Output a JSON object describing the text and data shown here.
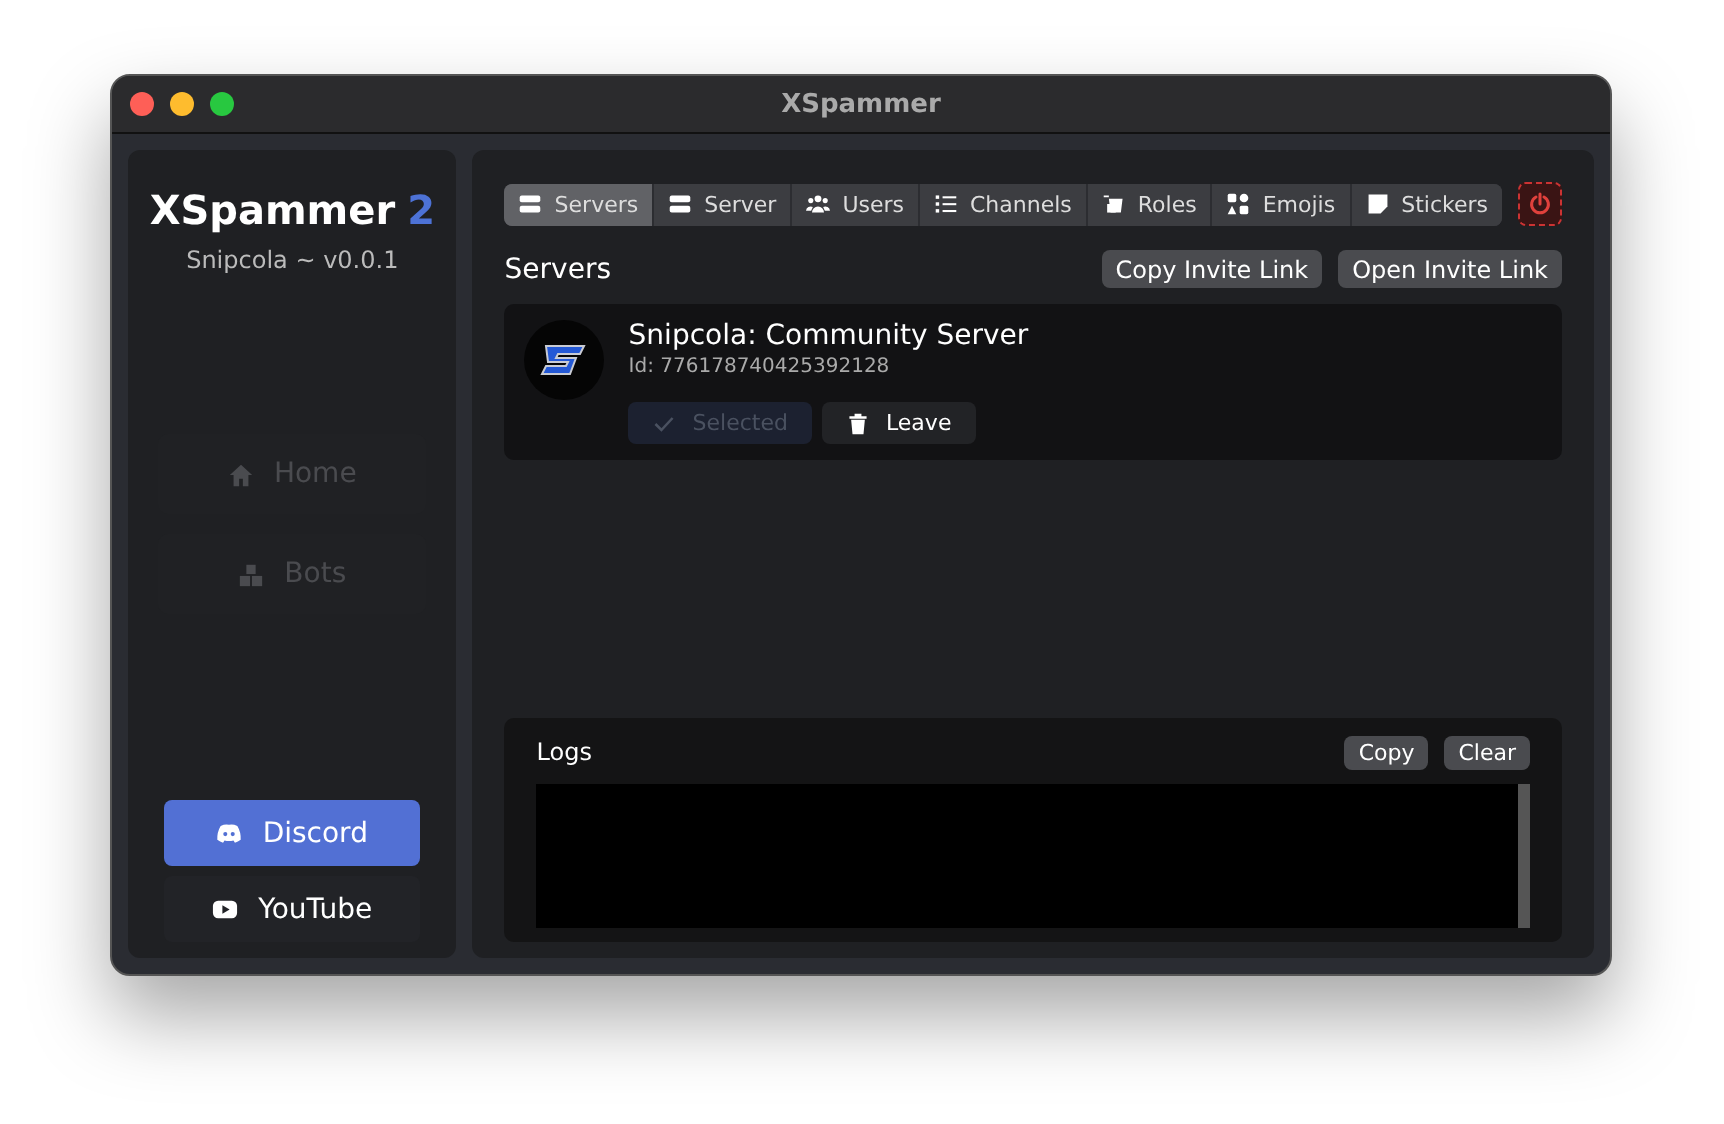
{
  "window": {
    "title": "XSpammer"
  },
  "sidebar": {
    "app_name": "XSpammer",
    "app_version_badge": "2",
    "subtitle": "Snipcola ~ v0.0.1",
    "nav": [
      {
        "label": "Home",
        "disabled": true
      },
      {
        "label": "Bots",
        "disabled": true
      }
    ],
    "links": [
      {
        "label": "Discord",
        "selected": true
      },
      {
        "label": "YouTube",
        "selected": false
      }
    ]
  },
  "tabs": [
    {
      "label": "Servers",
      "selected": true
    },
    {
      "label": "Server",
      "selected": false
    },
    {
      "label": "Users",
      "selected": false
    },
    {
      "label": "Channels",
      "selected": false
    },
    {
      "label": "Roles",
      "selected": false
    },
    {
      "label": "Emojis",
      "selected": false
    },
    {
      "label": "Stickers",
      "selected": false
    }
  ],
  "section": {
    "title": "Servers",
    "actions": [
      "Copy Invite Link",
      "Open Invite Link"
    ]
  },
  "servers": [
    {
      "name": "Snipcola: Community Server",
      "id": "Id: 776178740425392128",
      "buttons": [
        {
          "label": "Selected",
          "disabled": true
        },
        {
          "label": "Leave",
          "disabled": false
        }
      ]
    }
  ],
  "logs": {
    "title": "Logs",
    "buttons": [
      "Copy",
      "Clear"
    ]
  }
}
